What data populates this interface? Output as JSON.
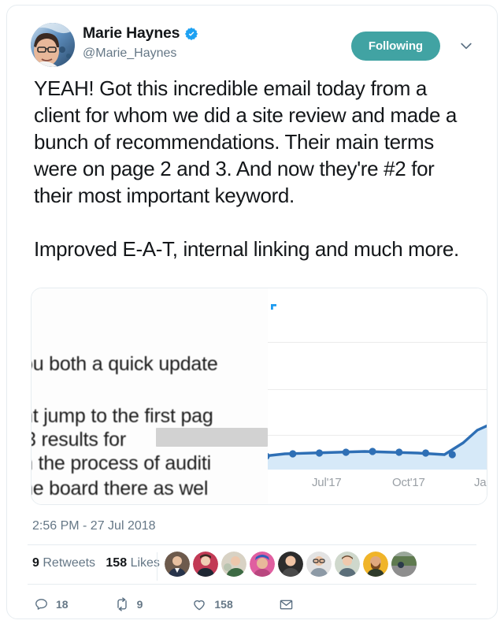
{
  "tweet": {
    "author": {
      "display_name": "Marie Haynes",
      "handle": "@Marie_Haynes",
      "verified_icon": "verified-badge-icon",
      "avatar_alt": "avatar"
    },
    "follow": {
      "button_label": "Following",
      "caret_icon": "chevron-down-icon"
    },
    "body": {
      "paragraph_1": "YEAH! Got this incredible email today from a client for whom we did a site review and made a bunch of recommendations. Their main terms were on page 2 and 3. And now they're #2 for their most important keyword.",
      "paragraph_2": "Improved E-A-T, internal linking and much more."
    },
    "timestamp": "2:56 PM - 27 Jul 2018",
    "stats": {
      "retweets_count": "9",
      "retweets_label": "Retweets",
      "likes_count": "158",
      "likes_label": "Likes"
    },
    "actions": {
      "reply": {
        "icon": "reply-icon",
        "count": "18"
      },
      "retweet": {
        "icon": "retweet-icon",
        "count": "9"
      },
      "like": {
        "icon": "heart-icon",
        "count": "158"
      },
      "message": {
        "icon": "envelope-icon",
        "count": ""
      }
    },
    "facepile": [
      {
        "name": "liker-avatar-1"
      },
      {
        "name": "liker-avatar-2"
      },
      {
        "name": "liker-avatar-3"
      },
      {
        "name": "liker-avatar-4"
      },
      {
        "name": "liker-avatar-5"
      },
      {
        "name": "liker-avatar-6"
      },
      {
        "name": "liker-avatar-7"
      },
      {
        "name": "liker-avatar-8"
      },
      {
        "name": "liker-avatar-9"
      }
    ]
  },
  "media": {
    "email_screenshot": {
      "line_1": "ou both a quick update",
      "line_2": "nt jump to the first pag",
      "line_3": " 3 results for",
      "line_4": "n the process of auditi",
      "line_5": "he board there as wel",
      "redaction_label": "redacted-keyword"
    }
  },
  "chart_data": {
    "type": "area",
    "title": "",
    "subtitle": "",
    "xlabel": "",
    "ylabel": "",
    "grid": true,
    "legend_position": "none",
    "tick_labels": [
      "Jul'17",
      "Oct'17",
      "Jan"
    ],
    "x": [
      0,
      1,
      2,
      3,
      4,
      5,
      6,
      7,
      8,
      9,
      10
    ],
    "values": [
      6,
      7,
      8,
      9,
      9,
      9,
      9,
      8,
      12,
      26,
      38
    ],
    "ylim": [
      0,
      100
    ],
    "line_color": "#2e6fb5",
    "fill_color": "#d6e9f8",
    "marker_color": "#2e6fb5",
    "gridline_color": "#ebebeb",
    "gridline_values": [
      30,
      55,
      78
    ]
  },
  "colors": {
    "following_teal": "#41a3a3",
    "verified_blue": "#1da1f2",
    "text_primary": "#14171a",
    "text_secondary": "#657786",
    "border": "#e6ecf0"
  }
}
